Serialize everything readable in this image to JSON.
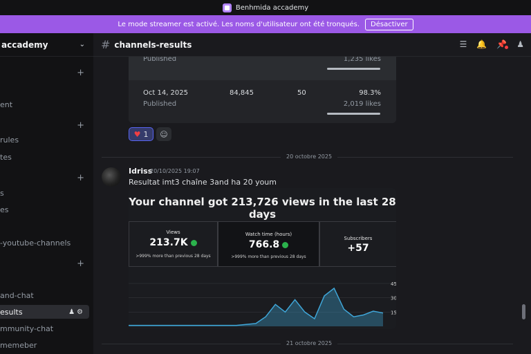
{
  "titlebar": {
    "server_name": "Benhmida accademy"
  },
  "banner": {
    "message": "Le mode streamer est activé. Les noms d'utilisateur ont été tronqués.",
    "button": "Désactiver"
  },
  "sidebar": {
    "server_name": "accademy",
    "items": [
      {
        "label": "ent"
      },
      {
        "label": "rules"
      },
      {
        "label": "tes"
      },
      {
        "label": "s"
      },
      {
        "label": "es"
      },
      {
        "label": "-youtube-channels"
      },
      {
        "label": "and-chat"
      },
      {
        "label": "esults"
      },
      {
        "label": "mmunity-chat"
      },
      {
        "label": "memeber"
      }
    ]
  },
  "header": {
    "channel": "channels-results"
  },
  "embed": {
    "row1": {
      "status": "Published",
      "likes": "1,235 likes"
    },
    "row2": {
      "date": "Oct 14, 2025",
      "views": "84,845",
      "count": "50",
      "percent": "98.3%",
      "status": "Published",
      "likes": "2,019 likes"
    }
  },
  "reactions": {
    "heart_count": "1"
  },
  "dividers": {
    "first": "20 octobre 2025",
    "second": "21 octobre 2025"
  },
  "message": {
    "author": "Idriss",
    "timestamp": "20/10/2025 19:07",
    "text": "Resultat imt3 chaîne 3and ha 20 youm"
  },
  "photo": {
    "headline": "Your channel got 213,726 views in the last 28 days",
    "cards": [
      {
        "label": "Views",
        "value": "213.7K",
        "note": ">999% more than previous 28 days"
      },
      {
        "label": "Watch time (hours)",
        "value": "766.8",
        "note": ">999% more than previous 28 days"
      },
      {
        "label": "Subscribers",
        "value": "+57"
      }
    ],
    "ticks": [
      "45",
      "30",
      "15"
    ],
    "series": [
      1,
      1,
      1,
      1,
      1,
      1,
      1,
      1,
      1,
      1,
      1,
      1,
      2,
      3,
      10,
      23,
      15,
      28,
      15,
      8,
      32,
      40,
      18,
      10,
      12,
      16,
      14
    ],
    "line_color": "#3fa6d8"
  }
}
